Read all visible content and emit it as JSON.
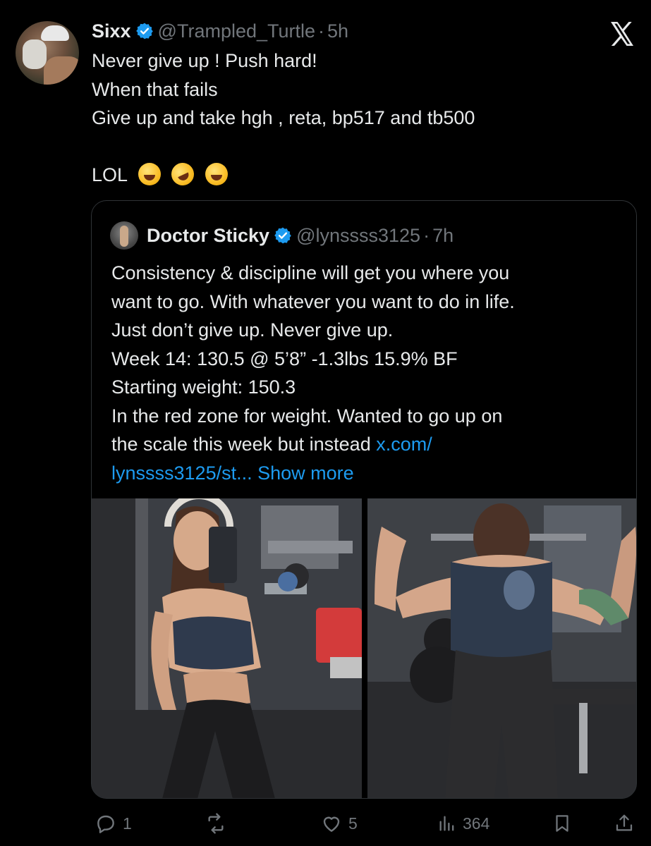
{
  "post": {
    "author_name": "Sixx",
    "handle": "@Trampled_Turtle",
    "separator": "·",
    "age": "5h",
    "lines": [
      "Never give up ! Push hard!",
      "When that fails",
      "Give up and take hgh , reta, bp517 and tb500",
      "",
      "LOL"
    ],
    "emojis": [
      "grinning-squinting-face",
      "rolling-on-floor-laughing",
      "face-with-tears-of-joy"
    ]
  },
  "quote": {
    "author_name": "Doctor Sticky",
    "handle": "@lynssss3125",
    "separator": "·",
    "age": "7h",
    "lines": [
      "Consistency & discipline will get you where you",
      "want to go. With whatever you want to do in life.",
      "Just don’t give up. Never give up.",
      "Week 14: 130.5 @ 5’8” -1.3lbs 15.9% BF",
      "Starting weight: 150.3",
      "In the red zone for weight. Wanted to go up on"
    ],
    "line7_text": "the scale this week but instead ",
    "line7_link": "x.com/",
    "line8_link": "lynssss3125/st...",
    "show_more": " Show more",
    "photos": [
      "gym-mirror-selfie",
      "gym-back-flex"
    ]
  },
  "actions": {
    "replies": "1",
    "reposts": "",
    "likes": "5",
    "views": "364"
  },
  "colors": {
    "background": "#000000",
    "text": "#e7e9ea",
    "muted": "#71767b",
    "link": "#1d9bf0",
    "border": "#2f3336",
    "verified": "#1d9bf0"
  }
}
